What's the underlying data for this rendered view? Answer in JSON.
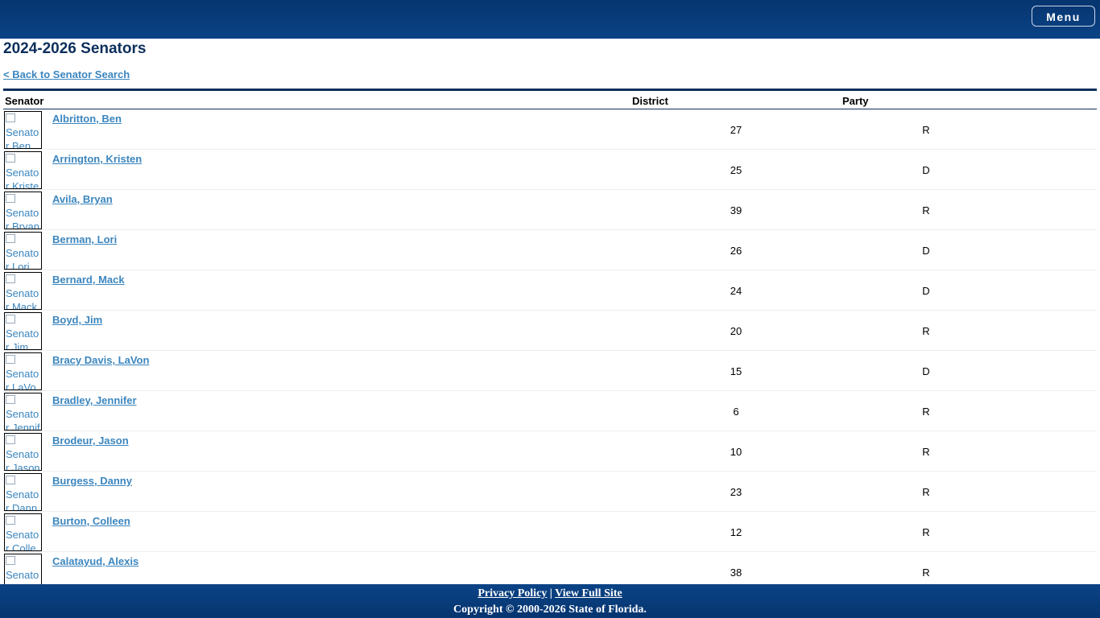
{
  "header": {
    "menu_label": "Menu"
  },
  "page": {
    "title": "2024-2026 Senators",
    "back_link": "< Back to Senator Search"
  },
  "table": {
    "columns": {
      "senator": "Senator",
      "district": "District",
      "party": "Party"
    },
    "photo_alt_prefix": "Senator",
    "rows": [
      {
        "name": "Albritton, Ben",
        "first": "Ben",
        "district": "27",
        "party": "R"
      },
      {
        "name": "Arrington, Kristen",
        "first": "Kristen",
        "district": "25",
        "party": "D"
      },
      {
        "name": "Avila, Bryan",
        "first": "Bryan",
        "district": "39",
        "party": "R"
      },
      {
        "name": "Berman, Lori",
        "first": "Lori",
        "district": "26",
        "party": "D"
      },
      {
        "name": "Bernard, Mack",
        "first": "Mack",
        "district": "24",
        "party": "D"
      },
      {
        "name": "Boyd, Jim",
        "first": "Jim",
        "district": "20",
        "party": "R"
      },
      {
        "name": "Bracy Davis, LaVon",
        "first": "LaVon",
        "district": "15",
        "party": "D"
      },
      {
        "name": "Bradley, Jennifer",
        "first": "Jennifer",
        "district": "6",
        "party": "R"
      },
      {
        "name": "Brodeur, Jason",
        "first": "Jason",
        "district": "10",
        "party": "R"
      },
      {
        "name": "Burgess, Danny",
        "first": "Danny",
        "district": "23",
        "party": "R"
      },
      {
        "name": "Burton, Colleen",
        "first": "Colleen",
        "district": "12",
        "party": "R"
      },
      {
        "name": "Calatayud, Alexis",
        "first": "Alexis",
        "district": "38",
        "party": "R"
      }
    ]
  },
  "footer": {
    "privacy_label": "Privacy Policy",
    "separator": "|",
    "full_site_label": "View Full Site",
    "copyright": "Copyright © 2000-2026 State of Florida."
  }
}
